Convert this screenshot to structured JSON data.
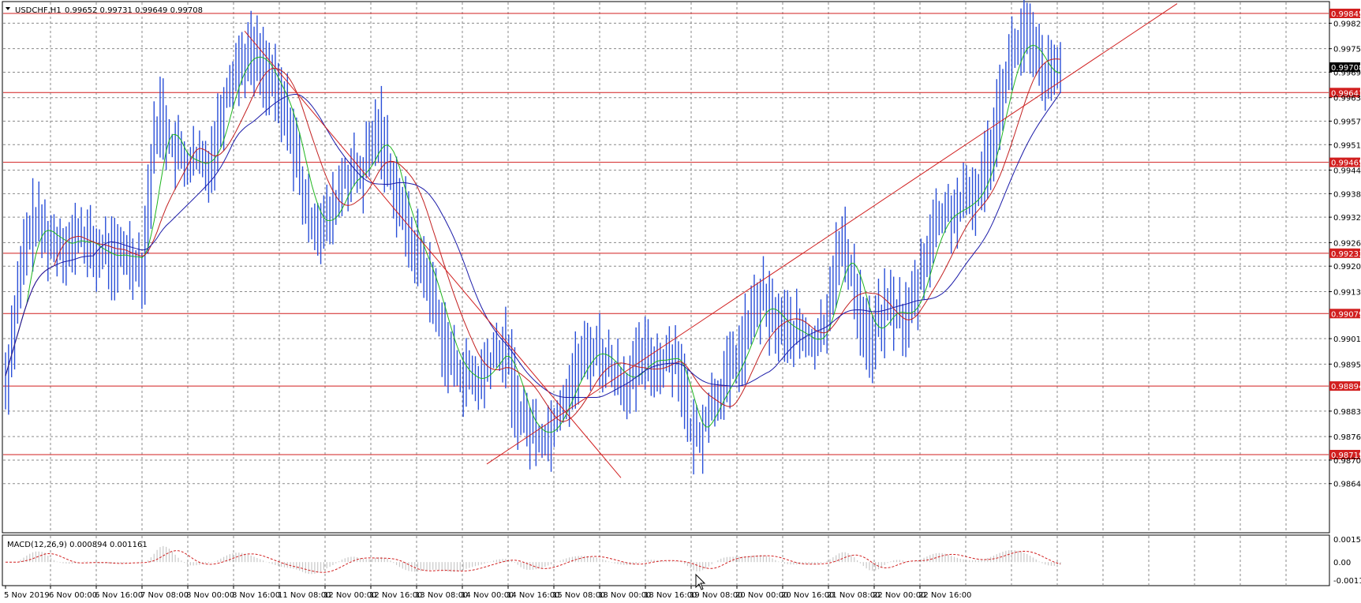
{
  "window": {
    "symbol_label": "USDCHF,H1",
    "ohlc_text": "0.99652 0.99731 0.99649 0.99708"
  },
  "macd": {
    "label": "MACD(12,26,9) 0.000894 0.001161",
    "axis_labels": [
      "0.00152",
      "0.00",
      "-0.00119"
    ]
  },
  "colors": {
    "background": "#ffffff",
    "grid": "#8a8a8a",
    "candles": "#2a4fd8",
    "level_line": "#d11f1f",
    "ma_fast": "#1fb51f",
    "ma_mid": "#c21f1f",
    "ma_slow": "#1a1aa8",
    "macd_hist": "#c8c8c8",
    "macd_signal": "#d11f1f"
  },
  "chart_data": {
    "type": "line",
    "instrument": "USDCHF",
    "timeframe": "H1",
    "x_tick_labels": [
      "5 Nov 2019",
      "6 Nov 00:00",
      "6 Nov 16:00",
      "7 Nov 08:00",
      "8 Nov 00:00",
      "8 Nov 16:00",
      "11 Nov 08:00",
      "12 Nov 00:00",
      "12 Nov 16:00",
      "13 Nov 08:00",
      "14 Nov 00:00",
      "14 Nov 16:00",
      "15 Nov 08:00",
      "18 Nov 00:00",
      "18 Nov 16:00",
      "19 Nov 08:00",
      "20 Nov 00:00",
      "20 Nov 16:00",
      "21 Nov 08:00",
      "22 Nov 00:00",
      "22 Nov 16:00"
    ],
    "y_tick_labels": [
      "0.99820",
      "0.99755",
      "0.99695",
      "0.99630",
      "0.99570",
      "0.99510",
      "0.99445",
      "0.99385",
      "0.99325",
      "0.99260",
      "0.99200",
      "0.99135",
      "0.99015",
      "0.98950",
      "0.98830",
      "0.98765",
      "0.98705",
      "0.98645"
    ],
    "ylim": [
      0.9864,
      0.9986
    ],
    "horizontal_levels": [
      0.99845,
      0.99643,
      0.99465,
      0.99233,
      0.99079,
      0.98894,
      0.98719
    ],
    "current_price": 0.99708,
    "trendlines": [
      {
        "name": "support",
        "points": [
          [
            "14 Nov 2019 08:00",
            0.98695
          ],
          [
            "25 Nov 2019 00:00",
            0.9987
          ]
        ]
      },
      {
        "name": "resistance",
        "points": [
          [
            "8 Nov 2019 13:00",
            0.998
          ],
          [
            "15 Nov 2019 04:00",
            0.9866
          ]
        ]
      }
    ],
    "close_series": [
      0.9892,
      0.9908,
      0.9924,
      0.9932,
      0.9929,
      0.9926,
      0.9927,
      0.9924,
      0.9929,
      0.9925,
      0.9923,
      0.9924,
      0.9921,
      0.9924,
      0.9922,
      0.992,
      0.9948,
      0.996,
      0.9951,
      0.9948,
      0.9946,
      0.9947,
      0.9945,
      0.9952,
      0.9963,
      0.997,
      0.9973,
      0.9975,
      0.9972,
      0.9968,
      0.9962,
      0.9958,
      0.9946,
      0.9933,
      0.9932,
      0.993,
      0.9934,
      0.9942,
      0.9944,
      0.9942,
      0.995,
      0.9956,
      0.9946,
      0.9938,
      0.993,
      0.9924,
      0.9919,
      0.9912,
      0.9902,
      0.9895,
      0.9893,
      0.9891,
      0.989,
      0.9895,
      0.9898,
      0.9899,
      0.9885,
      0.988,
      0.9878,
      0.9876,
      0.9879,
      0.9885,
      0.989,
      0.9895,
      0.9898,
      0.9899,
      0.9895,
      0.9893,
      0.989,
      0.9892,
      0.9897,
      0.9896,
      0.9895,
      0.9898,
      0.9896,
      0.9878,
      0.9876,
      0.9882,
      0.9887,
      0.989,
      0.9895,
      0.99,
      0.9907,
      0.9912,
      0.9908,
      0.9905,
      0.9904,
      0.9903,
      0.9901,
      0.99,
      0.9905,
      0.992,
      0.9925,
      0.9918,
      0.9907,
      0.99,
      0.9906,
      0.991,
      0.9908,
      0.9906,
      0.9913,
      0.9922,
      0.993,
      0.9933,
      0.9934,
      0.9935,
      0.9937,
      0.994,
      0.9948,
      0.996,
      0.997,
      0.9976,
      0.9979,
      0.9974,
      0.9969,
      0.9968,
      0.99708
    ],
    "indicators": {
      "moving_averages": [
        "fast (green)",
        "medium (red)",
        "slow (blue)"
      ],
      "macd": {
        "params": [
          12,
          26,
          9
        ],
        "main": 0.000894,
        "signal": 0.001161,
        "ylim": [
          -0.00119,
          0.00152
        ]
      }
    }
  }
}
